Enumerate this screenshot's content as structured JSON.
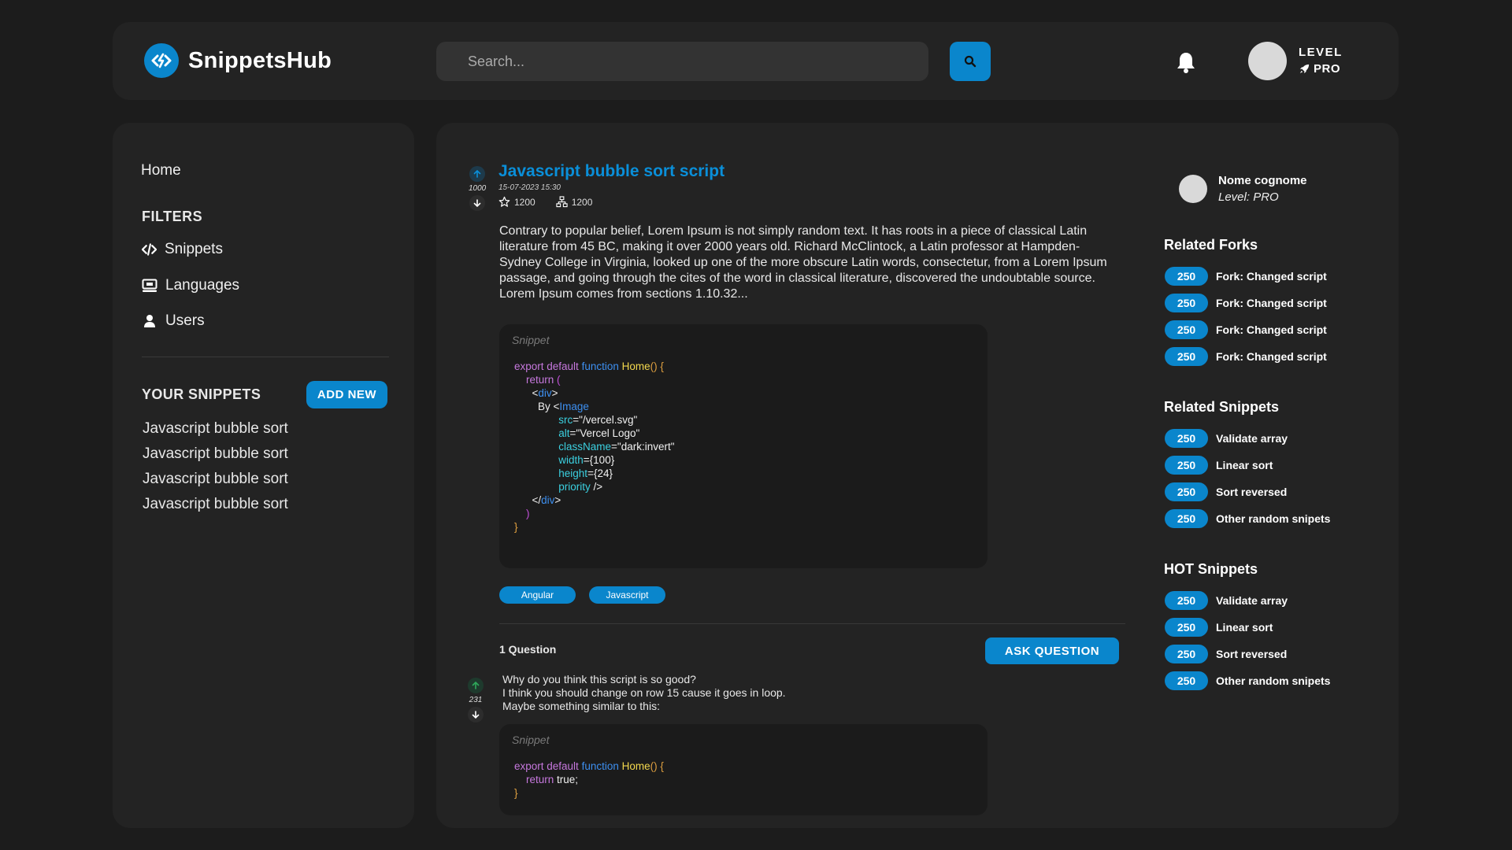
{
  "header": {
    "brand": "SnippetsHub",
    "search_placeholder": "Search...",
    "level_label": "LEVEL",
    "level_value": "PRO"
  },
  "sidebar": {
    "home": "Home",
    "filters_title": "FILTERS",
    "filters": [
      {
        "label": "Snippets",
        "icon": "code-icon"
      },
      {
        "label": "Languages",
        "icon": "monitor-icon"
      },
      {
        "label": "Users",
        "icon": "user-icon"
      }
    ],
    "your_snippets_title": "YOUR SNIPPETS",
    "add_new": "ADD NEW",
    "your_snippets": [
      "Javascript bubble sort",
      "Javascript bubble sort",
      "Javascript bubble sort",
      "Javascript bubble sort"
    ]
  },
  "post": {
    "title": "Javascript bubble sort script",
    "votes": "1000",
    "date": "15-07-2023 15:30",
    "stars": "1200",
    "forks": "1200",
    "body": "Contrary to popular belief, Lorem Ipsum is not simply random text. It has roots in a piece of classical Latin literature from 45 BC, making it over 2000 years old. Richard McClintock, a Latin professor at Hampden-Sydney College in Virginia, looked up one of the more obscure Latin words, consectetur, from a Lorem Ipsum passage, and going through the cites of the word in classical literature, discovered the undoubtable source. Lorem Ipsum comes from sections 1.10.32...",
    "snippet_label": "Snippet",
    "tags": [
      "Angular",
      "Javascript"
    ]
  },
  "questions": {
    "count_label": "1 Question",
    "ask_button": "ASK QUESTION",
    "items": [
      {
        "votes": "231",
        "lines": [
          "Why do you think this script is so good?",
          "I think you should change on row 15 cause it goes in loop.",
          "Maybe something similar to this:"
        ],
        "snippet_label": "Snippet"
      }
    ]
  },
  "author": {
    "name": "Nome cognome",
    "level": "Level: PRO"
  },
  "related_forks": {
    "title": "Related Forks",
    "items": [
      {
        "count": "250",
        "label": "Fork: Changed script"
      },
      {
        "count": "250",
        "label": "Fork: Changed script"
      },
      {
        "count": "250",
        "label": "Fork: Changed script"
      },
      {
        "count": "250",
        "label": "Fork: Changed script"
      }
    ]
  },
  "related_snippets": {
    "title": "Related Snippets",
    "items": [
      {
        "count": "250",
        "label": "Validate array"
      },
      {
        "count": "250",
        "label": "Linear sort"
      },
      {
        "count": "250",
        "label": "Sort reversed"
      },
      {
        "count": "250",
        "label": "Other random snipets"
      }
    ]
  },
  "hot_snippets": {
    "title": "HOT Snippets",
    "items": [
      {
        "count": "250",
        "label": "Validate array"
      },
      {
        "count": "250",
        "label": "Linear sort"
      },
      {
        "count": "250",
        "label": "Sort reversed"
      },
      {
        "count": "250",
        "label": "Other random snipets"
      }
    ]
  },
  "colors": {
    "accent": "#0a86cc",
    "background": "#1c1c1c",
    "card": "#232323",
    "code_bg": "#1b1b1b"
  }
}
